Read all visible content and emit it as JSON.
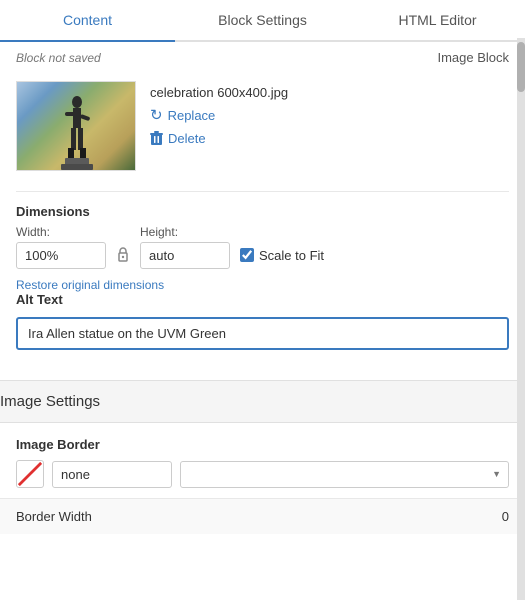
{
  "tabs": [
    {
      "id": "content",
      "label": "Content",
      "active": true
    },
    {
      "id": "block-settings",
      "label": "Block Settings",
      "active": false
    },
    {
      "id": "html-editor",
      "label": "HTML Editor",
      "active": false
    }
  ],
  "header": {
    "block_not_saved": "Block not saved",
    "image_block_label": "Image Block"
  },
  "image": {
    "filename": "celebration 600x400.jpg",
    "replace_label": "Replace",
    "delete_label": "Delete"
  },
  "dimensions": {
    "section_title": "Dimensions",
    "width_label": "Width:",
    "width_value": "100%",
    "height_label": "Height:",
    "height_value": "auto",
    "scale_to_fit_label": "Scale to Fit",
    "restore_label": "Restore original dimensions"
  },
  "alt_text": {
    "section_title": "Alt Text",
    "value": "Ira Allen statue on the UVM Green"
  },
  "image_settings": {
    "section_title": "Image Settings",
    "border_label": "Image Border",
    "border_style_value": "none",
    "border_color_value": "",
    "border_width_label": "Border Width",
    "border_width_value": "0"
  }
}
